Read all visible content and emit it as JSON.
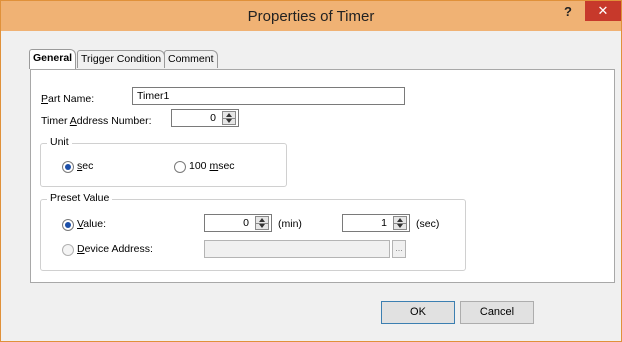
{
  "window": {
    "title": "Properties of Timer",
    "help_label": "?",
    "close_label": "✕"
  },
  "tabs": [
    {
      "label": "General",
      "active": true
    },
    {
      "label": "Trigger Condition",
      "active": false
    },
    {
      "label": "Comment",
      "active": false
    }
  ],
  "general": {
    "part_name": {
      "label_pre": "",
      "label_mnemonic": "P",
      "label_post": "art Name:",
      "value": "Timer1"
    },
    "timer_address": {
      "label_pre": "Timer ",
      "label_mnemonic": "A",
      "label_post": "ddress Number:",
      "value": "0"
    },
    "unit": {
      "title": "Unit",
      "options": [
        {
          "label_mnemonic": "s",
          "label_post": "ec",
          "label_pre": "",
          "checked": true
        },
        {
          "label_pre": "100 ",
          "label_mnemonic": "m",
          "label_post": "sec",
          "checked": false
        }
      ]
    },
    "preset": {
      "title": "Preset Value",
      "value_option": {
        "label_pre": "",
        "label_mnemonic": "V",
        "label_post": "alue:",
        "checked": true
      },
      "min_value": "0",
      "min_unit": "(min)",
      "sec_value": "1",
      "sec_unit": "(sec)",
      "device_option": {
        "label_pre": "",
        "label_mnemonic": "D",
        "label_post": "evice Address:",
        "checked": false
      },
      "device_value": "",
      "browse_label": "..."
    }
  },
  "buttons": {
    "ok": "OK",
    "cancel": "Cancel"
  },
  "colors": {
    "titlebar": "#f0b274",
    "close": "#c7392b",
    "radio_dot": "#1c4fa8"
  }
}
